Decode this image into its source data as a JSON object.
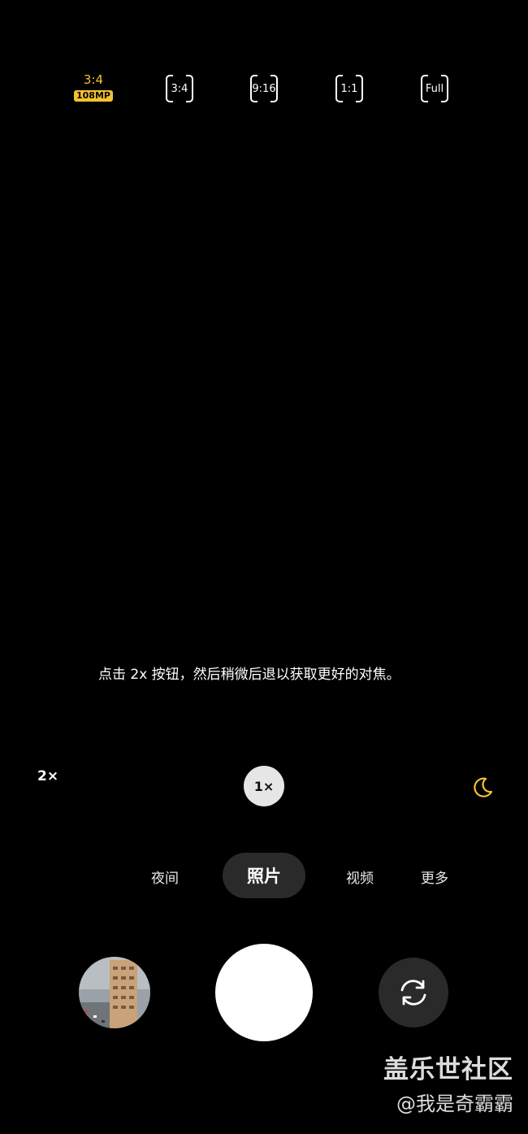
{
  "aspect_bar": {
    "selected": {
      "ratio": "3:4",
      "badge": "108MP"
    },
    "options": [
      "3:4",
      "9:16",
      "1:1",
      "Full"
    ]
  },
  "hint": "点击 2x 按钮，然后稍微后退以获取更好的对焦。",
  "zoom": {
    "two": "2×",
    "one": "1×"
  },
  "night_icon": "moon-icon",
  "modes": {
    "night": "夜间",
    "photo": "照片",
    "video": "视频",
    "more": "更多"
  },
  "controls": {
    "gallery": "gallery-thumbnail",
    "shutter": "shutter-button",
    "switch": "camera-switch-icon"
  },
  "watermark": {
    "site": "盖乐世社区",
    "author": "@我是奇霸霸"
  },
  "colors": {
    "accent": "#f2c230",
    "background": "#000000",
    "pill": "#2a2a2a"
  }
}
